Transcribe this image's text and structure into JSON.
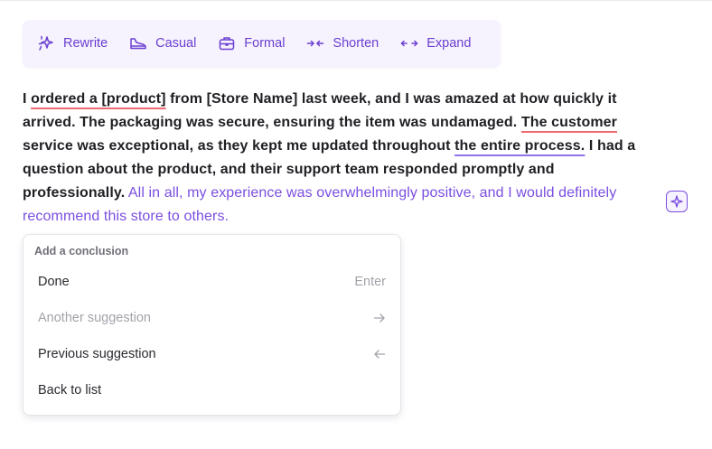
{
  "toolbar": {
    "rewrite": "Rewrite",
    "casual": "Casual",
    "formal": "Formal",
    "shorten": "Shorten",
    "expand": "Expand"
  },
  "text": {
    "s1": "I ",
    "s2": "ordered a [product]",
    "s3": " from [Store Name] last week, and I was amazed at how quickly it arrived. The packaging was secure, ensuring the item was undamaged. ",
    "s4": "The customer",
    "s5": " service was exceptional, as they kept me updated throughout ",
    "s6": "the entire process.",
    "s7": " I had a question about the product, and their support team responded promptly and professionally.",
    "suggestion": " All in all, my experience was overwhelmingly positive, and I would definitely recommend this store to others."
  },
  "menu": {
    "header": "Add a conclusion",
    "items": [
      {
        "label": "Done",
        "hint": "Enter"
      },
      {
        "label": "Another suggestion",
        "hint_icon": "arrow-right-icon"
      },
      {
        "label": "Previous suggestion",
        "hint_icon": "arrow-left-icon"
      },
      {
        "label": "Back to list"
      }
    ]
  },
  "colors": {
    "accent": "#7a4ee0",
    "toolbar_bg": "#f6f2fe",
    "underline_red": "#ef6b72",
    "underline_purple": "#8e72ea"
  }
}
